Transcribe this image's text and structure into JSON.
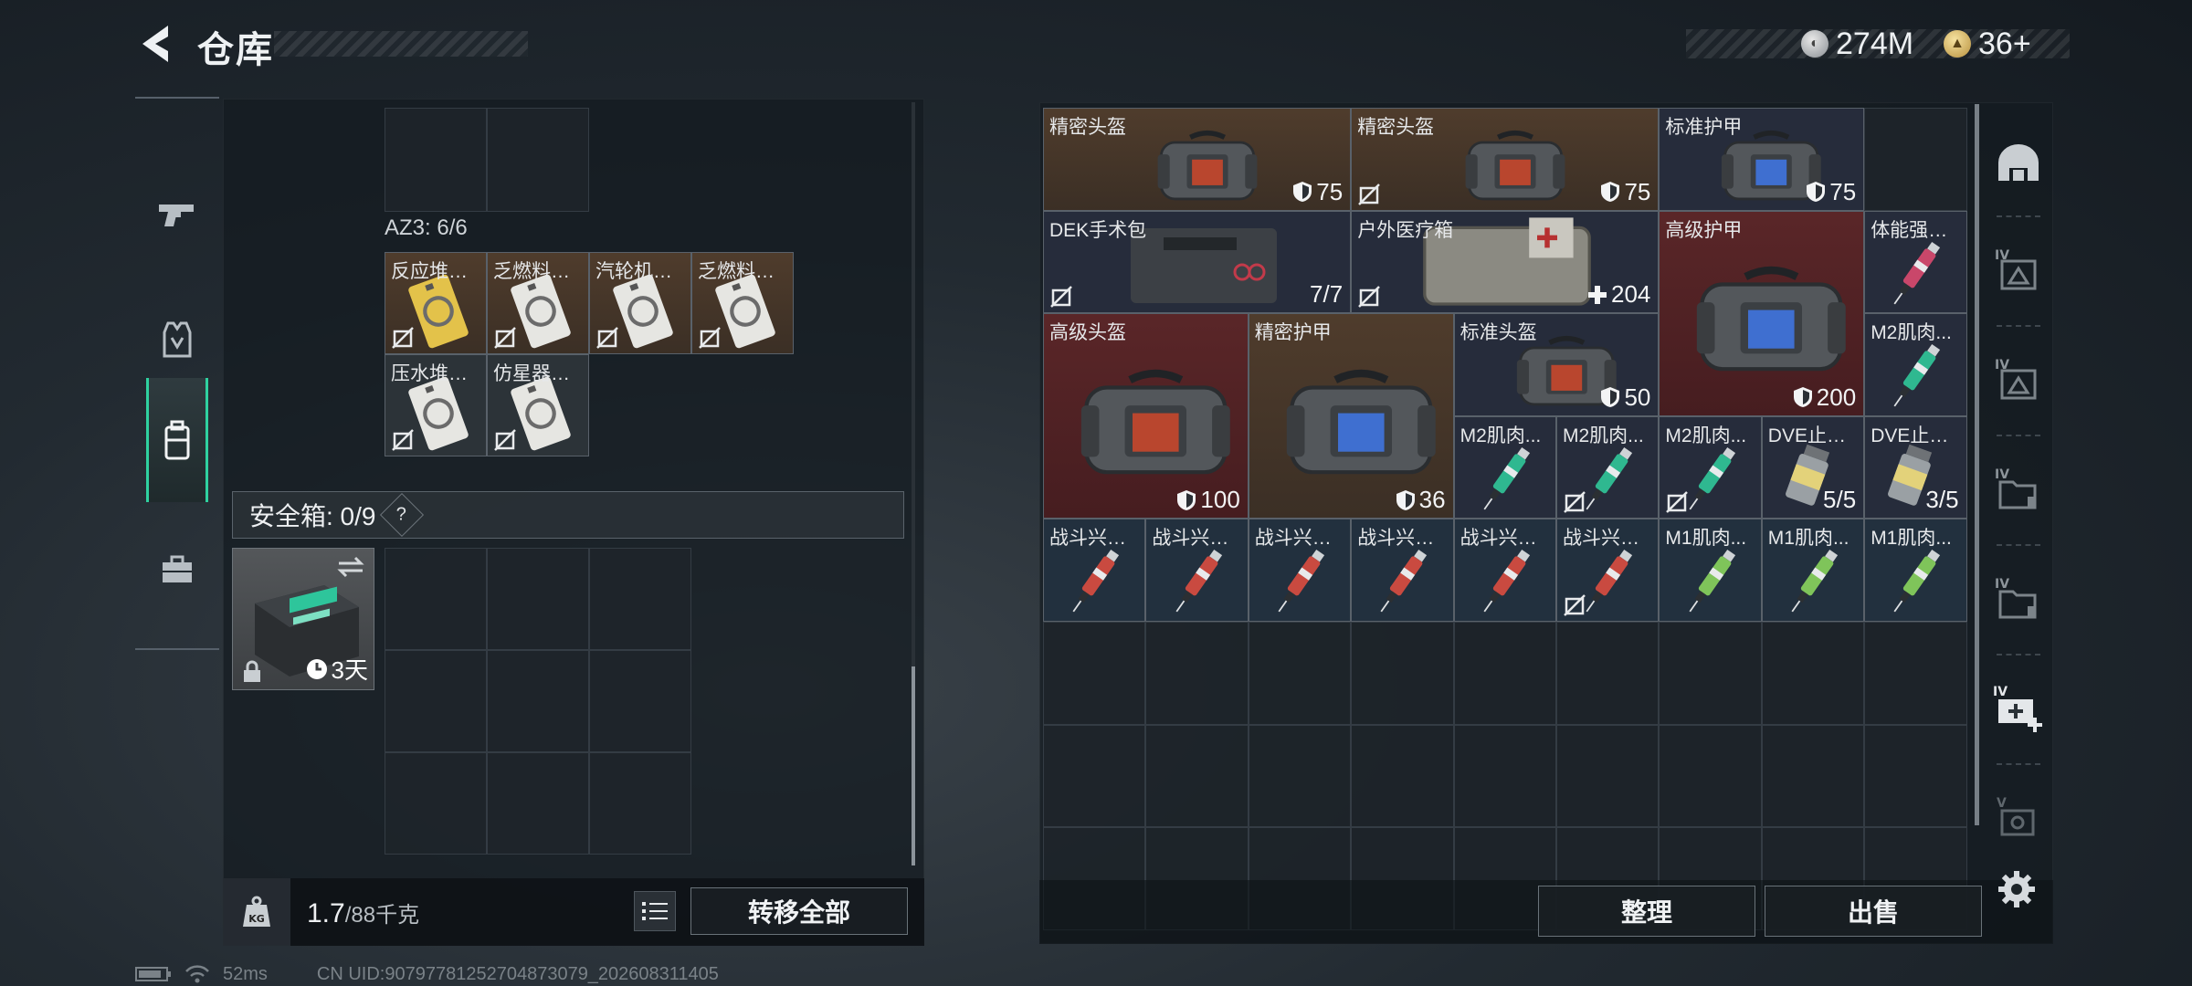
{
  "header": {
    "title": "仓库",
    "currency_silver": "274M",
    "currency_gold": "36+"
  },
  "left_tabs": [
    {
      "name": "weapons"
    },
    {
      "name": "gear"
    },
    {
      "name": "backpack",
      "active": true
    },
    {
      "name": "briefcase"
    }
  ],
  "left_panel": {
    "az3_label": "AZ3: 6/6",
    "az3_items": [
      {
        "label": "反应堆总...",
        "color": "yellow"
      },
      {
        "label": "乏燃料厂...",
        "color": "white"
      },
      {
        "label": "汽轮机控...",
        "color": "white"
      },
      {
        "label": "乏燃料厂...",
        "color": "white"
      },
      {
        "label": "压水堆服...",
        "color": "white"
      },
      {
        "label": "仿星器控...",
        "color": "white"
      }
    ],
    "safe_box": {
      "label": "安全箱: 0/9",
      "help": "?",
      "duration": "3天"
    },
    "weight": {
      "current": "1.7",
      "max_unit": "/88千克"
    },
    "transfer_all": "转移全部"
  },
  "right_panel": {
    "items": [
      {
        "label": "精密头盔",
        "value": "75",
        "icon": "shield"
      },
      {
        "label": "精密头盔",
        "value": "75",
        "icon": "shield"
      },
      {
        "label": "标准护甲",
        "value": "75",
        "icon": "shield"
      },
      {
        "label": "DEK手术包",
        "value": "7/7"
      },
      {
        "label": "户外医疗箱",
        "value": "204",
        "icon": "plus"
      },
      {
        "label": "高级护甲",
        "value": "200",
        "icon": "shield"
      },
      {
        "label": "体能强化剂",
        "value": ""
      },
      {
        "label": "M2肌肉...",
        "value": ""
      },
      {
        "label": "高级头盔",
        "value": "100",
        "icon": "shield"
      },
      {
        "label": "精密护甲",
        "value": "36",
        "icon": "shield"
      },
      {
        "label": "标准头盔",
        "value": "50",
        "icon": "shield"
      },
      {
        "label": "M2肌肉...",
        "value": ""
      },
      {
        "label": "M2肌肉...",
        "value": ""
      },
      {
        "label": "M2肌肉...",
        "value": ""
      },
      {
        "label": "DVE止疼片",
        "value": "5/5"
      },
      {
        "label": "DVE止疼片",
        "value": "3/5"
      },
      {
        "label": "战斗兴奋剂",
        "value": ""
      },
      {
        "label": "战斗兴奋剂",
        "value": ""
      },
      {
        "label": "战斗兴奋剂",
        "value": ""
      },
      {
        "label": "战斗兴奋剂",
        "value": ""
      },
      {
        "label": "战斗兴奋剂",
        "value": ""
      },
      {
        "label": "战斗兴奋剂",
        "value": ""
      },
      {
        "label": "M1肌肉...",
        "value": ""
      },
      {
        "label": "M1肌肉...",
        "value": ""
      },
      {
        "label": "M1肌肉...",
        "value": ""
      }
    ],
    "sort_button": "整理",
    "sell_button": "出售"
  },
  "right_strip": [
    {
      "name": "helmet-tab"
    },
    {
      "name": "container-IV-tab"
    },
    {
      "name": "container-IV-tab-2"
    },
    {
      "name": "folder-IV-tab"
    },
    {
      "name": "folder-IV-tab-2"
    },
    {
      "name": "medkit-IV-add-tab"
    },
    {
      "name": "container-V-tab"
    }
  ],
  "status": {
    "ping": "52ms",
    "uid": "CN UID:90797781252704873079_202608311405"
  },
  "colors": {
    "accent": "#2fd1a0",
    "brown_rarity": "#4f3c2c",
    "red_rarity": "#5a2628",
    "navy_rarity": "#262c3b",
    "teal_rarity": "#22303e"
  }
}
